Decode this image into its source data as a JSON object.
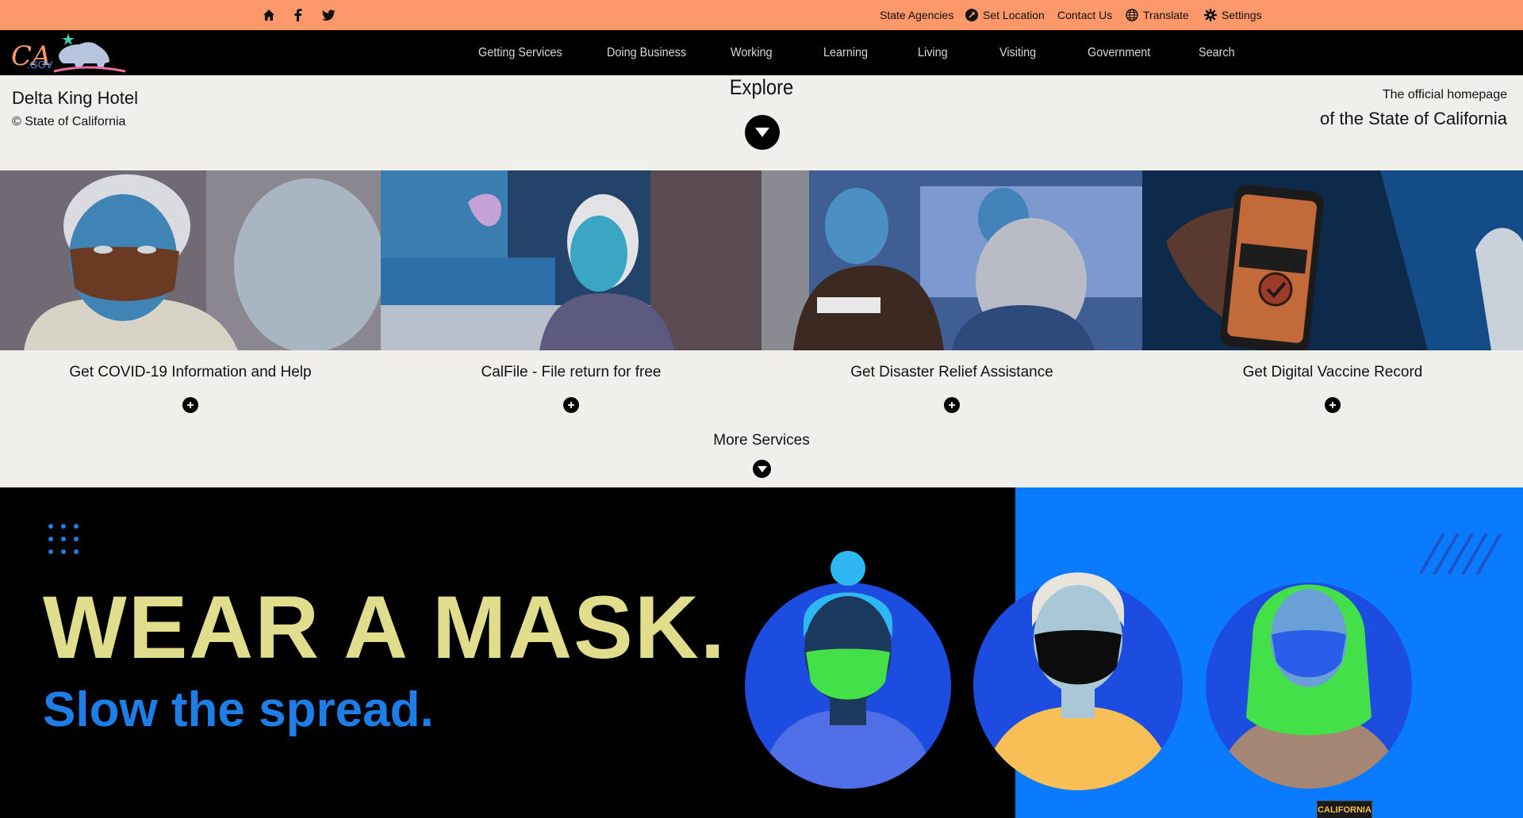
{
  "utility": {
    "home_icon": "home-icon",
    "facebook_icon": "facebook-icon",
    "twitter_icon": "twitter-icon",
    "state_agencies": "State Agencies",
    "set_location": "Set Location",
    "contact_us": "Contact Us",
    "translate": "Translate",
    "settings": "Settings"
  },
  "nav": {
    "items": [
      "Getting Services",
      "Doing Business",
      "Working",
      "Learning",
      "Living",
      "Visiting",
      "Government",
      "Search"
    ]
  },
  "hero": {
    "site_name": "Delta King Hotel",
    "copyright": "© State of California",
    "explore": "Explore",
    "official_line1": "The official homepage",
    "official_line2": "of the State of California"
  },
  "cards": [
    {
      "title": "Get COVID-19 Information and Help"
    },
    {
      "title": "CalFile - File return for free"
    },
    {
      "title": "Get Disaster Relief Assistance"
    },
    {
      "title": "Get Digital Vaccine Record"
    }
  ],
  "more_services": "More Services",
  "banner": {
    "headline": "WEAR A MASK.",
    "subline": "Slow the spread.",
    "badge": "CALIFORNIA"
  },
  "colors": {
    "utility_bg": "#fd986b",
    "nav_bg": "#000000",
    "page_bg": "#f1efec",
    "banner_headline": "#e0dd8c",
    "banner_sub": "#1e7ee8",
    "banner_blue": "#0a7bff"
  }
}
